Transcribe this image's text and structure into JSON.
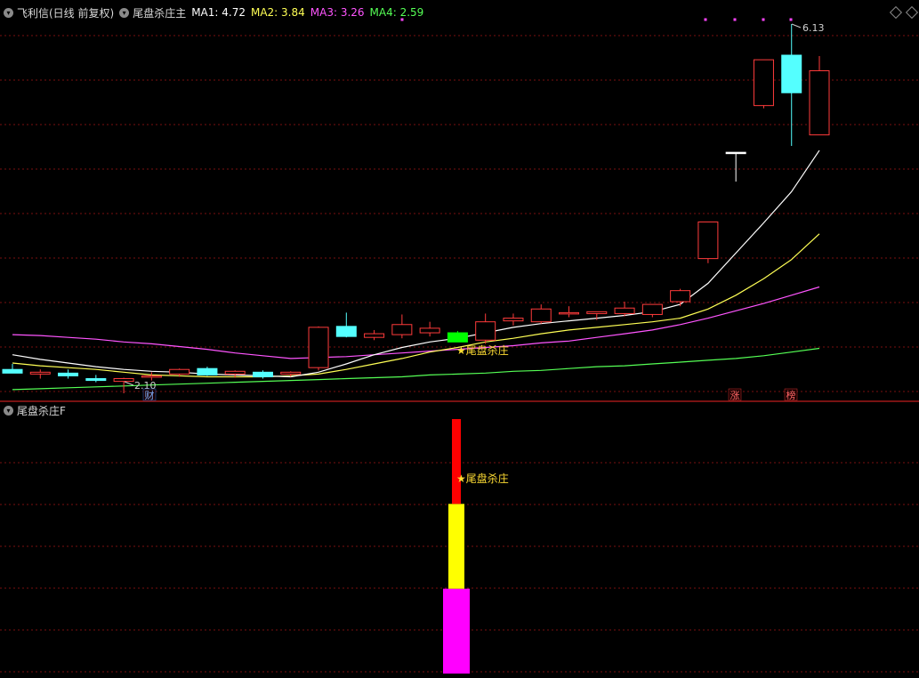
{
  "header": {
    "title": "飞利信(日线 前复权)",
    "indicator": "尾盘杀庄主",
    "ma": [
      {
        "label": "MA1: 4.72",
        "color": "#ffffff"
      },
      {
        "label": "MA2: 3.84",
        "color": "#ffff55"
      },
      {
        "label": "MA3: 3.26",
        "color": "#ff55ff"
      },
      {
        "label": "MA4: 2.59",
        "color": "#55ff55"
      }
    ]
  },
  "subpanel": {
    "title": "尾盘杀庄F"
  },
  "colors": {
    "up": "#ff3b3b",
    "down": "#54ffff",
    "ma1": "#ffffff",
    "ma2": "#ffff55",
    "ma3": "#ff55ff",
    "ma4": "#55ff55",
    "grid": "#7a1010",
    "divider": "#a01818",
    "signal_star": "#ffdd33",
    "dots": "#ff44ff",
    "signal_candle": "#00ff00"
  },
  "chart_data": [
    {
      "type": "candlestick",
      "ylim": [
        1.5,
        6.5
      ],
      "candles": [
        {
          "o": 2.36,
          "h": 2.42,
          "l": 2.32,
          "c": 2.32
        },
        {
          "o": 2.31,
          "h": 2.36,
          "l": 2.26,
          "c": 2.33
        },
        {
          "o": 2.32,
          "h": 2.36,
          "l": 2.26,
          "c": 2.29
        },
        {
          "o": 2.26,
          "h": 2.3,
          "l": 2.22,
          "c": 2.24
        },
        {
          "o": 2.23,
          "h": 2.27,
          "l": 2.1,
          "c": 2.26
        },
        {
          "o": 2.28,
          "h": 2.33,
          "l": 2.24,
          "c": 2.29
        },
        {
          "o": 2.31,
          "h": 2.37,
          "l": 2.28,
          "c": 2.36
        },
        {
          "o": 2.37,
          "h": 2.39,
          "l": 2.29,
          "c": 2.3
        },
        {
          "o": 2.31,
          "h": 2.35,
          "l": 2.27,
          "c": 2.34
        },
        {
          "o": 2.33,
          "h": 2.35,
          "l": 2.26,
          "c": 2.28
        },
        {
          "o": 2.31,
          "h": 2.34,
          "l": 2.28,
          "c": 2.33
        },
        {
          "o": 2.38,
          "h": 2.83,
          "l": 2.35,
          "c": 2.82
        },
        {
          "o": 2.83,
          "h": 2.98,
          "l": 2.71,
          "c": 2.72
        },
        {
          "o": 2.71,
          "h": 2.79,
          "l": 2.68,
          "c": 2.75
        },
        {
          "o": 2.74,
          "h": 2.96,
          "l": 2.7,
          "c": 2.85
        },
        {
          "o": 2.76,
          "h": 2.88,
          "l": 2.72,
          "c": 2.81
        },
        {
          "o": 2.76,
          "h": 2.78,
          "l": 2.66,
          "c": 2.66
        },
        {
          "o": 2.68,
          "h": 2.97,
          "l": 2.64,
          "c": 2.88
        },
        {
          "o": 2.89,
          "h": 2.97,
          "l": 2.84,
          "c": 2.92
        },
        {
          "o": 2.88,
          "h": 3.07,
          "l": 2.86,
          "c": 3.02
        },
        {
          "o": 2.98,
          "h": 3.05,
          "l": 2.93,
          "c": 2.98
        },
        {
          "o": 2.97,
          "h": 2.99,
          "l": 2.9,
          "c": 2.99
        },
        {
          "o": 2.97,
          "h": 3.1,
          "l": 2.94,
          "c": 3.03
        },
        {
          "o": 2.96,
          "h": 3.05,
          "l": 2.93,
          "c": 3.07
        },
        {
          "o": 3.1,
          "h": 3.24,
          "l": 3.05,
          "c": 3.22
        },
        {
          "o": 3.57,
          "h": 3.97,
          "l": 3.52,
          "c": 3.97
        },
        {
          "o": 4.73,
          "h": 4.73,
          "l": 4.41,
          "c": 4.73
        },
        {
          "o": 5.24,
          "h": 5.73,
          "l": 5.21,
          "c": 5.74
        },
        {
          "o": 5.79,
          "h": 6.13,
          "l": 4.8,
          "c": 5.38
        },
        {
          "o": 4.92,
          "h": 5.78,
          "l": 4.92,
          "c": 5.62
        }
      ],
      "candle_x": [
        14,
        44,
        76,
        108,
        139,
        202,
        233,
        265,
        296,
        327,
        358,
        390,
        421,
        452,
        483,
        515,
        546,
        577,
        608,
        640,
        670,
        702,
        733,
        765,
        826,
        858,
        889,
        921
      ],
      "candle_x_note": "",
      "ma1": [
        2.52,
        2.47,
        2.43,
        2.39,
        2.36,
        2.34,
        2.33,
        2.31,
        2.3,
        2.29,
        2.28,
        2.33,
        2.42,
        2.52,
        2.6,
        2.66,
        2.7,
        2.76,
        2.82,
        2.86,
        2.89,
        2.92,
        2.95,
        2.99,
        3.07,
        3.3,
        3.63,
        3.96,
        4.3,
        4.75
      ],
      "ma2": [
        2.43,
        2.4,
        2.38,
        2.36,
        2.33,
        2.3,
        2.29,
        2.28,
        2.28,
        2.28,
        2.29,
        2.31,
        2.36,
        2.42,
        2.48,
        2.55,
        2.6,
        2.66,
        2.7,
        2.75,
        2.79,
        2.82,
        2.85,
        2.88,
        2.92,
        3.02,
        3.17,
        3.35,
        3.56,
        3.84
      ],
      "ma3": [
        2.74,
        2.73,
        2.71,
        2.69,
        2.66,
        2.64,
        2.61,
        2.58,
        2.54,
        2.51,
        2.48,
        2.49,
        2.5,
        2.52,
        2.54,
        2.56,
        2.58,
        2.6,
        2.62,
        2.65,
        2.67,
        2.71,
        2.75,
        2.79,
        2.85,
        2.92,
        3.0,
        3.08,
        3.17,
        3.26
      ],
      "ma4": [
        2.14,
        2.15,
        2.16,
        2.17,
        2.18,
        2.19,
        2.2,
        2.21,
        2.22,
        2.23,
        2.24,
        2.25,
        2.26,
        2.27,
        2.28,
        2.3,
        2.31,
        2.32,
        2.34,
        2.35,
        2.37,
        2.39,
        2.4,
        2.42,
        2.44,
        2.46,
        2.48,
        2.51,
        2.55,
        2.59
      ],
      "annotations": {
        "high_label": "6.13",
        "low_label": "2.10",
        "signal_label": "★尾盘杀庄",
        "badges": [
          "财",
          "涨",
          "榜"
        ]
      }
    },
    {
      "type": "bar",
      "title": "尾盘杀庄F",
      "ylim": [
        0,
        3
      ],
      "stack": [
        {
          "from": 0,
          "to": 1,
          "color": "#ff00ff"
        },
        {
          "from": 1,
          "to": 2,
          "color": "#ffff00"
        },
        {
          "from": 2,
          "to": 3,
          "color": "#ff0000"
        }
      ],
      "signal_label": "★尾盘杀庄"
    }
  ]
}
